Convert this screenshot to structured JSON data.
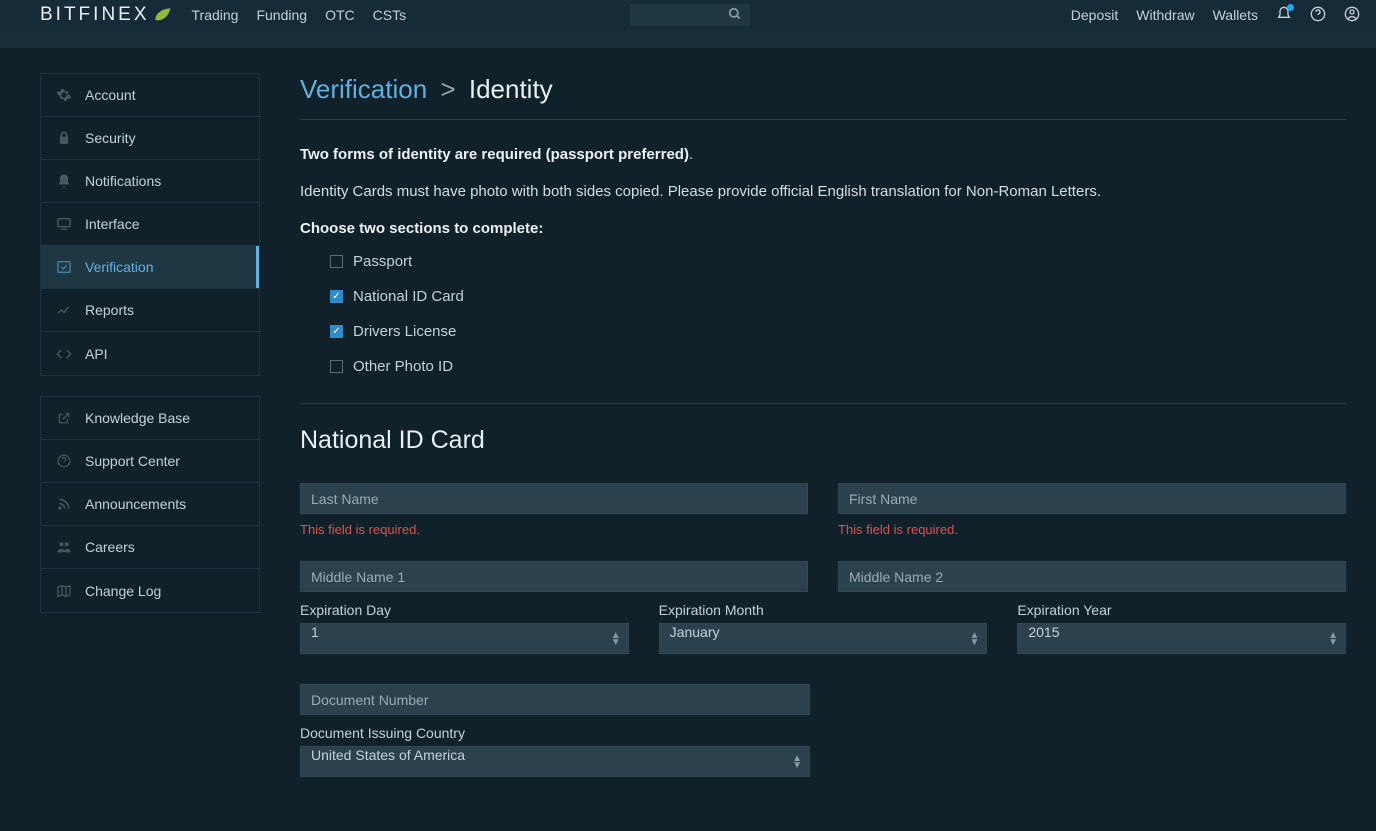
{
  "brand": "BITFINEX",
  "nav": {
    "trading": "Trading",
    "funding": "Funding",
    "otc": "OTC",
    "csts": "CSTs"
  },
  "navRight": {
    "deposit": "Deposit",
    "withdraw": "Withdraw",
    "wallets": "Wallets"
  },
  "sidebar": {
    "group1": [
      {
        "name": "account",
        "label": "Account",
        "icon": "gear"
      },
      {
        "name": "security",
        "label": "Security",
        "icon": "lock"
      },
      {
        "name": "notifications",
        "label": "Notifications",
        "icon": "bell"
      },
      {
        "name": "interface",
        "label": "Interface",
        "icon": "monitor"
      },
      {
        "name": "verification",
        "label": "Verification",
        "icon": "check",
        "active": true
      },
      {
        "name": "reports",
        "label": "Reports",
        "icon": "chart"
      },
      {
        "name": "api",
        "label": "API",
        "icon": "code"
      }
    ],
    "group2": [
      {
        "name": "knowledge-base",
        "label": "Knowledge Base",
        "icon": "external"
      },
      {
        "name": "support-center",
        "label": "Support Center",
        "icon": "help"
      },
      {
        "name": "announcements",
        "label": "Announcements",
        "icon": "rss"
      },
      {
        "name": "careers",
        "label": "Careers",
        "icon": "people"
      },
      {
        "name": "change-log",
        "label": "Change Log",
        "icon": "map"
      }
    ]
  },
  "breadcrumb": {
    "root": "Verification",
    "sep": ">",
    "leaf": "Identity"
  },
  "intro1a": "Two forms of identity are required (passport preferred)",
  "intro1b": ".",
  "intro2": "Identity Cards must have photo with both sides copied. Please provide official English translation for Non-Roman Letters.",
  "chooseLabel": "Choose two sections to complete:",
  "options": {
    "passport": {
      "label": "Passport",
      "checked": false
    },
    "national": {
      "label": "National ID Card",
      "checked": true
    },
    "drivers": {
      "label": "Drivers License",
      "checked": true
    },
    "other": {
      "label": "Other Photo ID",
      "checked": false
    }
  },
  "sectionTitle": "National ID Card",
  "form": {
    "lastName": {
      "placeholder": "Last Name",
      "value": "",
      "error": "This field is required."
    },
    "firstName": {
      "placeholder": "First Name",
      "value": "",
      "error": "This field is required."
    },
    "middle1": {
      "placeholder": "Middle Name 1",
      "value": ""
    },
    "middle2": {
      "placeholder": "Middle Name 2",
      "value": ""
    },
    "expDay": {
      "label": "Expiration Day",
      "value": "1"
    },
    "expMonth": {
      "label": "Expiration Month",
      "value": "January"
    },
    "expYear": {
      "label": "Expiration Year",
      "value": "2015"
    },
    "docNumber": {
      "placeholder": "Document Number",
      "value": ""
    },
    "docCountry": {
      "label": "Document Issuing Country",
      "value": "United States of America"
    }
  }
}
